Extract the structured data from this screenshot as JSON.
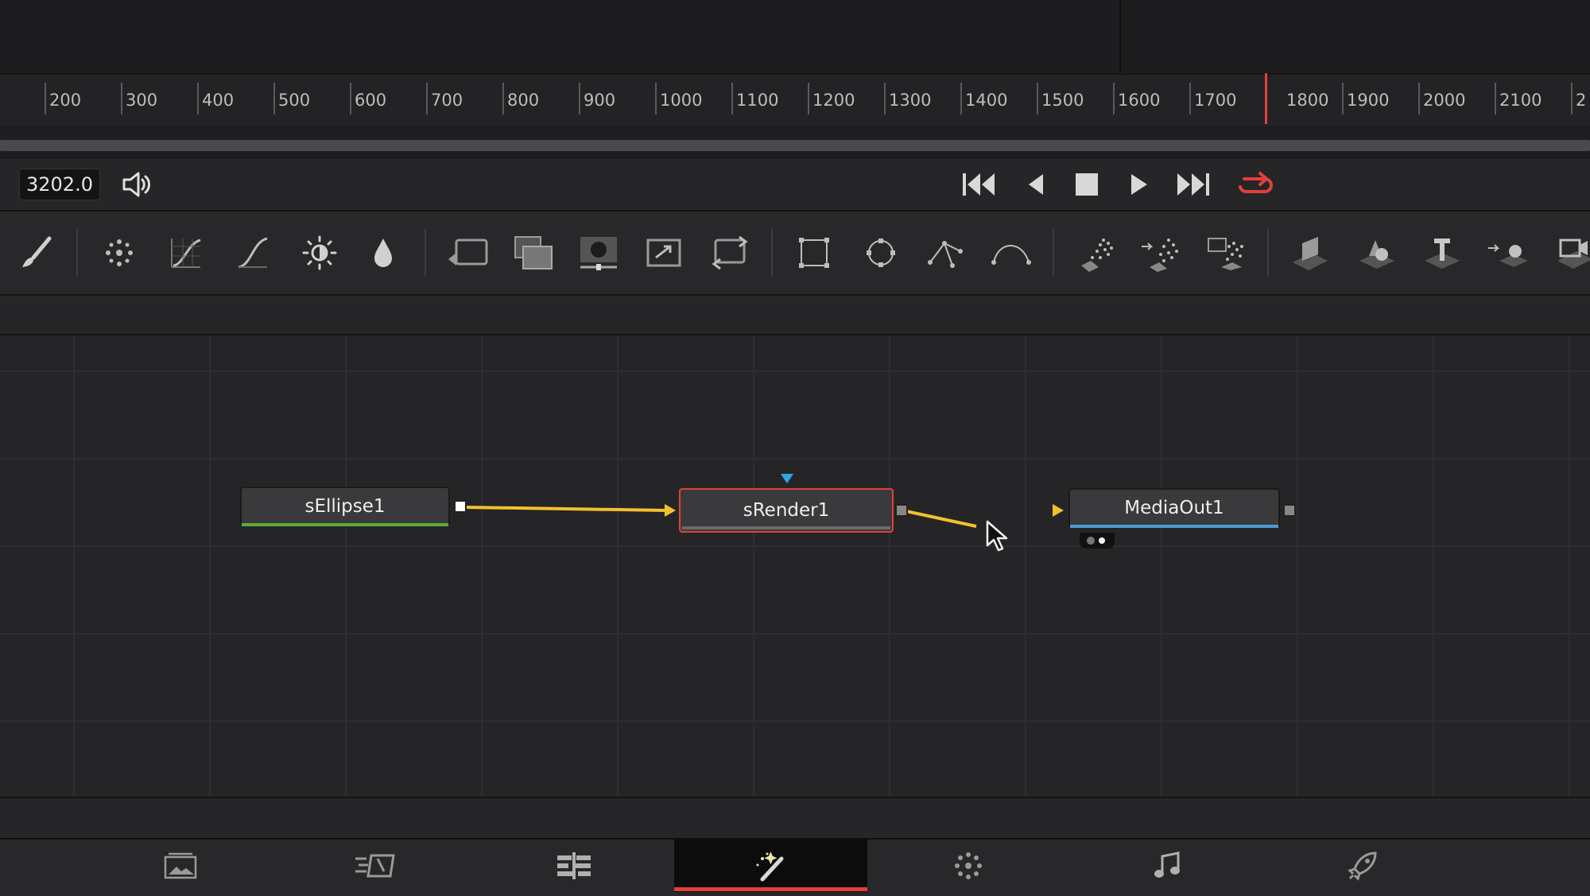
{
  "ruler": {
    "ticks": [
      "200",
      "300",
      "400",
      "500",
      "600",
      "700",
      "800",
      "900",
      "1000",
      "1100",
      "1200",
      "1300",
      "1400",
      "1500",
      "1600",
      "1700",
      "1800",
      "1900",
      "2000",
      "2100",
      "2"
    ]
  },
  "transport": {
    "frame_value": "3202.0",
    "buttons": [
      "speaker-icon",
      "go-to-start-icon",
      "step-back-icon",
      "stop-icon",
      "play-icon",
      "go-to-end-icon",
      "loop-icon"
    ]
  },
  "toolbar": {
    "tools": [
      "paint-brush-icon",
      "particle-icon",
      "curves-icon",
      "spline-icon",
      "brightness-contrast-icon",
      "color-drop-icon",
      "background-icon",
      "merge-icon",
      "mask-icon",
      "transform-icon",
      "resize-icon",
      "rectangle-mask-icon",
      "ellipse-mask-icon",
      "polygon-mask-icon",
      "bspline-mask-icon",
      "particle-emitter-icon",
      "particle-render-icon",
      "particle-scatter-icon",
      "3d-plane-icon",
      "3d-shapes-icon",
      "3d-text-icon",
      "3d-render-icon",
      "3d-camera-icon"
    ]
  },
  "nodes": {
    "ellipse": "sEllipse1",
    "render": "sRender1",
    "mediaout": "MediaOut1"
  },
  "pages": [
    "media-page-icon",
    "cut-page-icon",
    "edit-page-icon",
    "fusion-page-icon",
    "color-page-icon",
    "fairlight-page-icon",
    "deliver-page-icon"
  ],
  "colors": {
    "accent_red": "#e0413a",
    "link_yellow": "#f2c12e",
    "node_green": "#5fa83a",
    "node_blue": "#4b9bd6",
    "input_blue": "#2aa7e6"
  }
}
